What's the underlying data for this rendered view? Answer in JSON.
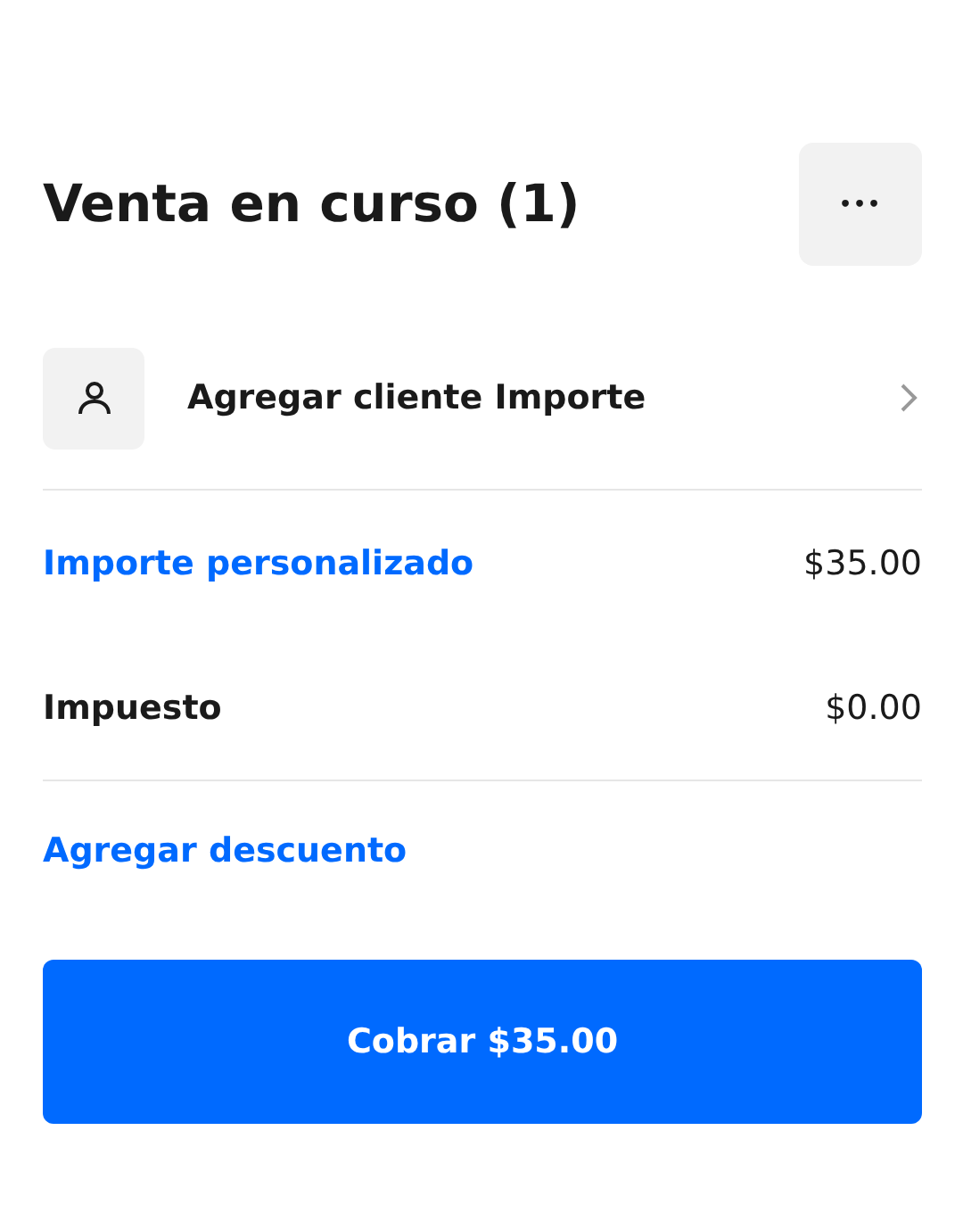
{
  "header": {
    "title": "Venta en curso (1)",
    "menu_label": "•••"
  },
  "customer": {
    "label": "Agregar cliente Importe"
  },
  "lines": [
    {
      "kind": "link",
      "label": "Importe personalizado",
      "amount": "$35.00"
    },
    {
      "kind": "plain",
      "label": "Impuesto",
      "amount": "$0.00"
    }
  ],
  "discount": {
    "label": "Agregar descuento"
  },
  "charge_button": {
    "label": "Cobrar $35.00"
  }
}
